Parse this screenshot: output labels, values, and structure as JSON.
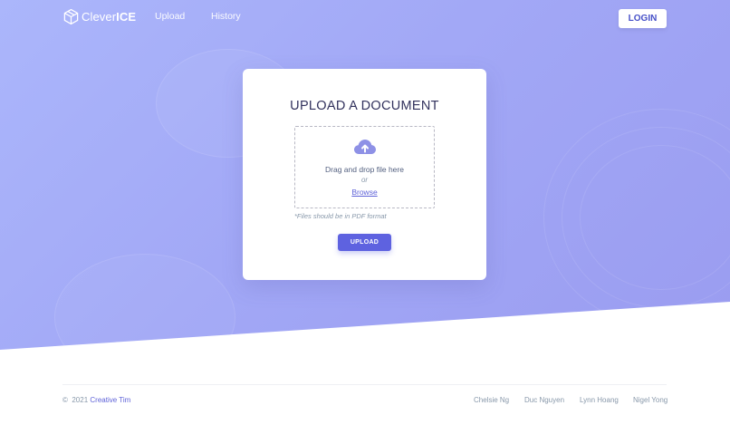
{
  "nav": {
    "brand_prefix": "Clever",
    "brand_suffix": "ICE",
    "links": [
      "Upload",
      "History"
    ],
    "login_label": "LOGIN"
  },
  "card": {
    "title": "UPLOAD A DOCUMENT",
    "drop_text": "Drag and drop file here",
    "or_text": "or",
    "browse_label": "Browse",
    "hint": "*Files should be in PDF format",
    "upload_label": "UPLOAD"
  },
  "footer": {
    "copyright_symbol": "©",
    "year": "2021",
    "author": "Creative Tim",
    "links": [
      "Chelsie Ng",
      "Duc Nguyen",
      "Lynn Hoang",
      "Nigel Yong"
    ]
  },
  "icons": {
    "brand": "cube-icon",
    "upload": "cloud-upload-icon"
  },
  "colors": {
    "accent": "#5e62e0",
    "hero_start": "#abb6fb",
    "hero_end": "#9a9cf0"
  }
}
